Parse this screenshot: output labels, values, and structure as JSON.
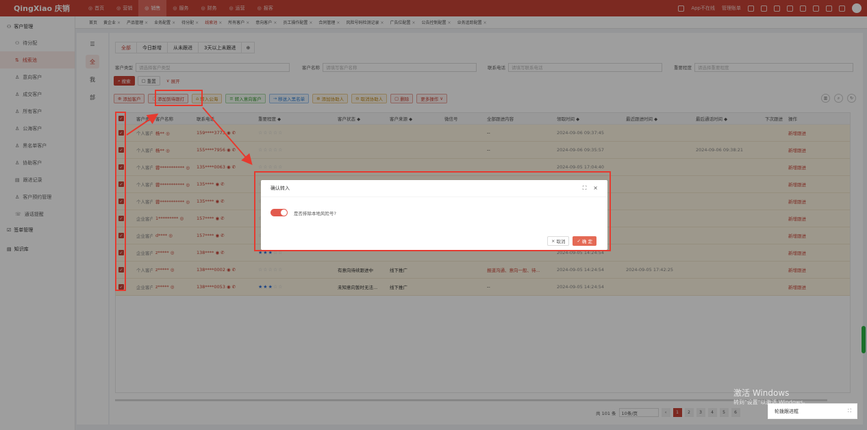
{
  "app": {
    "logo": "QingXiao 庆销"
  },
  "topnav": [
    {
      "label": "首页",
      "icon": "home-icon"
    },
    {
      "label": "营销",
      "icon": "marketing-icon"
    },
    {
      "label": "销售",
      "icon": "sales-icon",
      "active": true
    },
    {
      "label": "服务",
      "icon": "service-icon"
    },
    {
      "label": "财务",
      "icon": "finance-icon"
    },
    {
      "label": "运营",
      "icon": "operations-icon"
    },
    {
      "label": "报客",
      "icon": "report-icon"
    }
  ],
  "topright": {
    "app": "App不在线",
    "user_text": "管理账单"
  },
  "sidebar": {
    "group1": "客户管理",
    "items": [
      {
        "label": "待分配",
        "icon": "users-icon"
      },
      {
        "label": "线索池",
        "icon": "funnel-icon",
        "active": true
      },
      {
        "label": "意向客户",
        "icon": "user-icon"
      },
      {
        "label": "成交客户",
        "icon": "check-user-icon"
      },
      {
        "label": "所有客户",
        "icon": "user-group-icon"
      },
      {
        "label": "公海客户",
        "icon": "sea-icon"
      },
      {
        "label": "黑名单客户",
        "icon": "block-user-icon"
      },
      {
        "label": "协助客户",
        "icon": "handshake-icon"
      },
      {
        "label": "跟进记录",
        "icon": "record-icon"
      },
      {
        "label": "客户预约管理",
        "icon": "calendar-icon"
      },
      {
        "label": "通话提醒",
        "icon": "bell-icon"
      }
    ],
    "group2": "签单管理",
    "group3": "知识库"
  },
  "tabs": [
    {
      "label": "首页"
    },
    {
      "label": "黄企业"
    },
    {
      "label": "产品管理"
    },
    {
      "label": "业务配置"
    },
    {
      "label": "待分配"
    },
    {
      "label": "线索池",
      "active": true
    },
    {
      "label": "所有客户"
    },
    {
      "label": "意向客户"
    },
    {
      "label": "员工操作配置"
    },
    {
      "label": "合同管理"
    },
    {
      "label": "风险号码检测记录"
    },
    {
      "label": "广告位配置"
    },
    {
      "label": "公告控制配置"
    },
    {
      "label": "业务追踪配置"
    }
  ],
  "leftstrip": [
    {
      "label": "☰",
      "icon": "menu-toggle-icon"
    },
    {
      "label": "全",
      "active": true
    },
    {
      "label": "我"
    },
    {
      "label": "部"
    }
  ],
  "subtabs": [
    "全部",
    "今日新增",
    "从未跟进",
    "3天以上未跟进",
    "⊕"
  ],
  "filters": {
    "customer_type_label": "客户类型",
    "customer_type_placeholder": "请选择客户类型",
    "customer_name_label": "客户名称",
    "customer_name_placeholder": "请填写客户名称",
    "phone_label": "联系电话",
    "phone_placeholder": "请填写联系电话",
    "followup_label": "重要程度",
    "followup_placeholder": "请选择重要程度"
  },
  "btns1": {
    "search": "搜索",
    "reset": "重置",
    "expand": "展开"
  },
  "btns2": {
    "add_customer": "添加客户",
    "add_temp": "添加到待跟打",
    "to_sea": "转入公海",
    "to_intent": "转入意向客户",
    "to_blacklist": "移送入黑名单",
    "add_assist": "添加协助人",
    "cancel_assist": "取消协助人",
    "delete": "删除",
    "more": "更多操作"
  },
  "table": {
    "headers": [
      "客户类型 ◆",
      "客户名称",
      "联系电话",
      "重要程度 ◆",
      "客户状态 ◆",
      "客户来源 ◆",
      "微信号",
      "全部跟进内容",
      "领取时间 ◆",
      "最近跟进时间 ◆",
      "最后通话时间 ◆",
      "下次跟进",
      "操作"
    ],
    "rows": [
      {
        "type": "个人客户",
        "name": "杨** ◎",
        "phone": "159****3773",
        "stars": 0,
        "status": "",
        "source": "",
        "wx": "",
        "content": "--",
        "received": "2024-09-06 09:37:45",
        "recent": "",
        "lastcall": "",
        "action": "新增跟进"
      },
      {
        "type": "个人客户",
        "name": "杨** ◎",
        "phone": "155****7956",
        "stars": 0,
        "status": "",
        "source": "",
        "wx": "",
        "content": "--",
        "received": "2024-09-06 09:35:57",
        "recent": "",
        "lastcall": "2024-09-06 09:38:21",
        "action": "新增跟进"
      },
      {
        "type": "个人客户",
        "name": "蓉*********** ◎",
        "phone": "135****0063",
        "stars": 0,
        "status": "",
        "source": "",
        "wx": "",
        "content": "",
        "received": "2024-09-05 17:04:40",
        "recent": "",
        "lastcall": "",
        "action": "新增跟进"
      },
      {
        "type": "个人客户",
        "name": "蓉*********** ◎",
        "phone": "135****",
        "stars": 0,
        "status": "",
        "source": "",
        "wx": "",
        "content": "",
        "received": "2024-09-05 17:01:51",
        "recent": "",
        "lastcall": "",
        "action": "新增跟进"
      },
      {
        "type": "个人客户",
        "name": "蓉*********** ◎",
        "phone": "135****",
        "stars": 0,
        "status": "",
        "source": "",
        "wx": "",
        "content": "",
        "received": "2024-09-05 17:01:51",
        "recent": "",
        "lastcall": "",
        "action": "新增跟进"
      },
      {
        "type": "企业客户",
        "name": "1********* ◎",
        "phone": "157****",
        "stars": 0,
        "status": "",
        "source": "",
        "wx": "",
        "content": "",
        "received": "2024-09-05 15:45:08",
        "recent": "",
        "lastcall": "",
        "action": "新增跟进"
      },
      {
        "type": "企业客户",
        "name": "d**** ◎",
        "phone": "157****",
        "stars": 0,
        "status": "",
        "source": "",
        "wx": "",
        "content": "",
        "received": "2024-09-05 15:42:38",
        "recent": "",
        "lastcall": "",
        "action": "新增跟进"
      },
      {
        "type": "企业客户",
        "name": "z***** ◎",
        "phone": "138****",
        "stars": 3,
        "status": "",
        "source": "",
        "wx": "",
        "content": "",
        "received": "2024-09-05 14:24:54",
        "recent": "",
        "lastcall": "",
        "action": "新增跟进"
      },
      {
        "type": "个人客户",
        "name": "z***** ◎",
        "phone": "138****0002",
        "stars": 0,
        "status": "有意向待续跟进中",
        "source": "线下推广",
        "wx": "",
        "content": "报道沟通、意向一般、待...",
        "received": "2024-09-05 14:24:54",
        "recent": "2024-09-05 17:42:25",
        "lastcall": "",
        "action": "新增跟进"
      },
      {
        "type": "企业客户",
        "name": "z***** ◎",
        "phone": "138****0053",
        "stars": 3,
        "status": "未知意向暂时无法...",
        "source": "线下推广",
        "wx": "",
        "content": "--",
        "received": "2024-09-05 14:24:54",
        "recent": "",
        "lastcall": "",
        "action": "新增跟进"
      }
    ]
  },
  "pagination": {
    "total": "共 101 条",
    "size": "10条/页",
    "pages": [
      "1",
      "2",
      "3",
      "4",
      "5",
      "6"
    ]
  },
  "dialog": {
    "title": "确认转入",
    "question": "是否排除本地风险号?",
    "cancel": "取消",
    "confirm": "确 定",
    "cancel_icon": "×",
    "confirm_icon": "✓"
  },
  "watermark": {
    "line1": "激活 Windows",
    "line2": "转到\"设置\"以激活 Windows。"
  },
  "float": {
    "label": "轮拨跟进框"
  },
  "colors": {
    "brand": "#c94336",
    "annotation": "#e53a2f"
  }
}
